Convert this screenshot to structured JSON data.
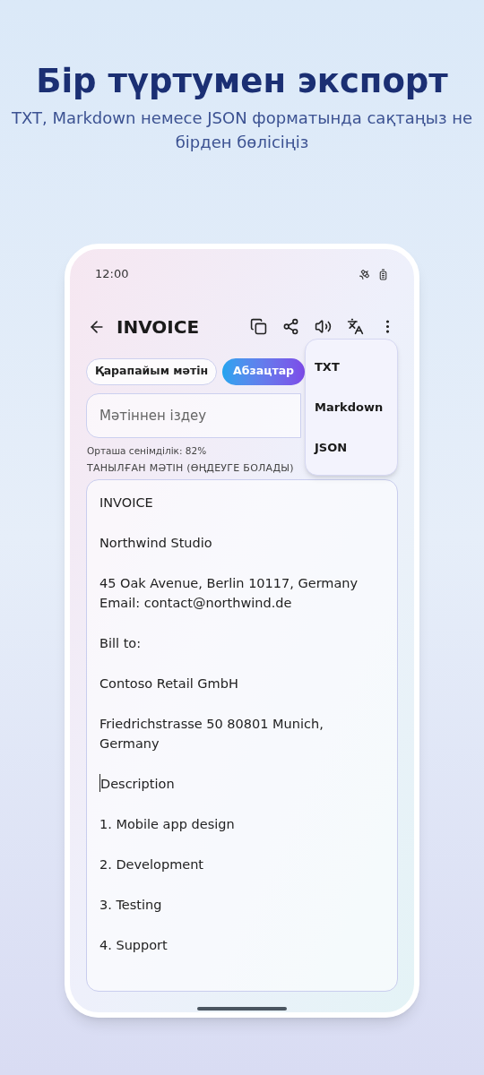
{
  "headline": {
    "title": "Бір түртумен экспорт",
    "subtitle": "TXT, Markdown немесе JSON форматында сақтаңыз не бірден бөлісіңіз"
  },
  "status_bar": {
    "time": "12:00"
  },
  "toolbar": {
    "title": "INVOICE"
  },
  "chips": [
    {
      "label": "Қарапайым мәтін",
      "selected": false
    },
    {
      "label": "Абзацтар",
      "selected": true
    }
  ],
  "search": {
    "placeholder": "Мәтіннен іздеу"
  },
  "confidence": "Орташа сенімділік: 82%",
  "section_label": "ТАНЫЛҒАН МӘТІН (ӨҢДЕУГЕ БОЛАДЫ)",
  "paragraphs": [
    {
      "lines": [
        "INVOICE"
      ],
      "caret": false
    },
    {
      "lines": [
        "Northwind Studio"
      ],
      "caret": false
    },
    {
      "lines": [
        "45 Oak Avenue, Berlin 10117, Germany",
        "Email: contact@northwind.de"
      ],
      "caret": false
    },
    {
      "lines": [
        "Bill to:"
      ],
      "caret": false
    },
    {
      "lines": [
        "Contoso Retail GmbH"
      ],
      "caret": false
    },
    {
      "lines": [
        "Friedrichstrasse 50 80801 Munich,",
        "Germany"
      ],
      "caret": false
    },
    {
      "lines": [
        "Description"
      ],
      "caret": true
    },
    {
      "lines": [
        "1. Mobile app design"
      ],
      "caret": false
    },
    {
      "lines": [
        "2. Development"
      ],
      "caret": false
    },
    {
      "lines": [
        "3. Testing"
      ],
      "caret": false
    },
    {
      "lines": [
        "4. Support"
      ],
      "caret": false
    }
  ],
  "export_menu": {
    "items": [
      "TXT",
      "Markdown",
      "JSON"
    ]
  }
}
